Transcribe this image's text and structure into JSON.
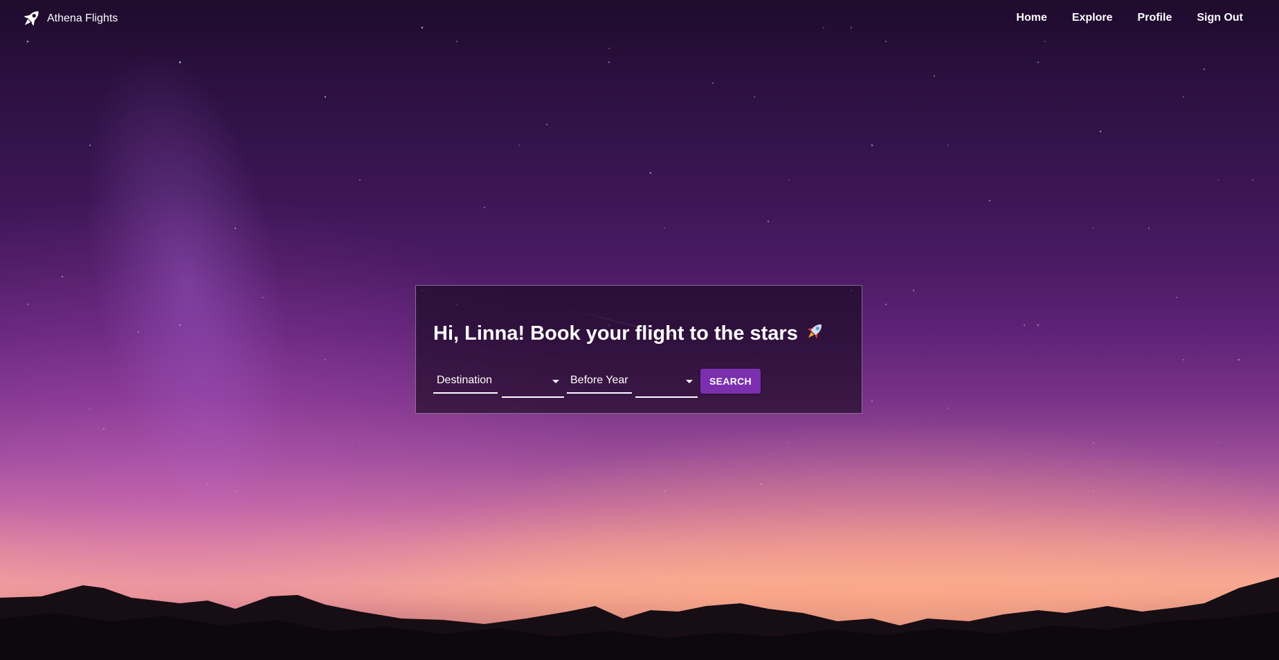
{
  "navbar": {
    "brand": "Athena Flights",
    "brand_icon": "rocket-icon",
    "links": [
      {
        "label": "Home"
      },
      {
        "label": "Explore"
      },
      {
        "label": "Profile"
      },
      {
        "label": "Sign Out"
      }
    ]
  },
  "search_card": {
    "title": "Hi, Linna! Book your flight to the stars",
    "title_icon": "rocket-icon",
    "destination_label": "Destination",
    "destination_value": "",
    "before_year_label": "Before Year",
    "before_year_value": "",
    "search_label": "SEARCH"
  },
  "colors": {
    "accent": "#7b2fae",
    "text": "#ffffff",
    "card_background": "rgba(20,6,28,0.62)"
  }
}
